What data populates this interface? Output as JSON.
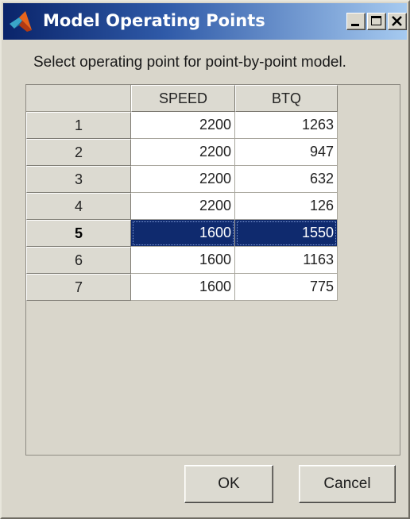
{
  "window": {
    "title": "Model Operating Points"
  },
  "prompt": "Select operating point for point-by-point model.",
  "table": {
    "columns": [
      "SPEED",
      "BTQ"
    ],
    "rows": [
      {
        "label": "1",
        "speed": "2200",
        "btq": "1263"
      },
      {
        "label": "2",
        "speed": "2200",
        "btq": "947"
      },
      {
        "label": "3",
        "speed": "2200",
        "btq": "632"
      },
      {
        "label": "4",
        "speed": "2200",
        "btq": "126"
      },
      {
        "label": "5",
        "speed": "1600",
        "btq": "1550"
      },
      {
        "label": "6",
        "speed": "1600",
        "btq": "1163"
      },
      {
        "label": "7",
        "speed": "1600",
        "btq": "775"
      }
    ],
    "selected_row": "5"
  },
  "buttons": {
    "ok": "OK",
    "cancel": "Cancel"
  },
  "colors": {
    "titlebar_start": "#0a246a",
    "titlebar_end": "#a6caf0",
    "selection": "#0f2a6e",
    "window_bg": "#d9d6cb"
  }
}
